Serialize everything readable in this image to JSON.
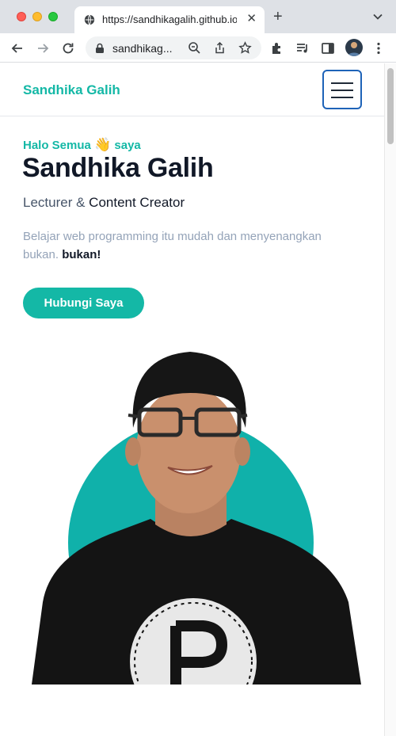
{
  "browser": {
    "tab_title": "https://sandhikagalih.github.io/",
    "tab_close": "✕",
    "new_tab": "+",
    "url": "sandhikag...",
    "icons": [
      "globe-icon",
      "chevron-down-icon",
      "back-icon",
      "forward-icon",
      "reload-icon",
      "lock-icon",
      "zoom-icon",
      "share-icon",
      "star-icon",
      "extensions-icon",
      "media-icon",
      "side-panel-icon",
      "profile-avatar",
      "kebab-menu-icon"
    ]
  },
  "site": {
    "brand": "Sandhika Galih",
    "greeting_prefix": "Halo Semua",
    "greeting_emoji": "👋",
    "greeting_suffix": "saya",
    "name": "Sandhika Galih",
    "role_primary": "Lecturer &",
    "role_secondary": "Content Creator",
    "description": "Belajar web programming itu mudah dan menyenangkan bukan.",
    "description_bold": "bukan!",
    "cta_label": "Hubungi Saya"
  },
  "colors": {
    "accent": "#14b8a6",
    "heading": "#111827",
    "muted": "#94a3b8",
    "hamburger_border": "#1e63b8"
  }
}
